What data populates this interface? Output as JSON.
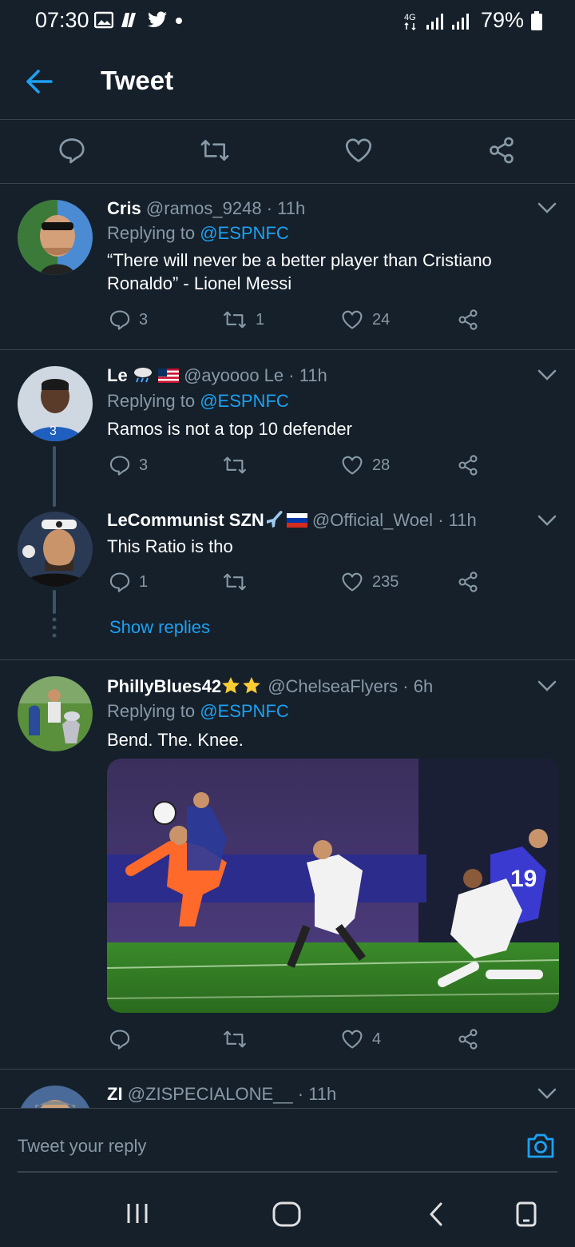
{
  "status_bar": {
    "time": "07:30",
    "network": "4G",
    "battery": "79%"
  },
  "header": {
    "title": "Tweet"
  },
  "tweets": [
    {
      "name": "Cris",
      "handle": "@ramos_9248",
      "time": "· 11h",
      "replying_prefix": "Replying to",
      "replying_to": "@ESPNFC",
      "text": "“There will never be a better player than Cristiano Ronaldo” - Lionel Messi",
      "replies": "3",
      "retweets": "1",
      "likes": "24"
    },
    {
      "name": "Le",
      "handle": "@ayoooo Le",
      "time": "· 11h",
      "replying_prefix": "Replying to",
      "replying_to": "@ESPNFC",
      "text": "Ramos is not a top 10 defender",
      "replies": "3",
      "retweets": "",
      "likes": "28"
    },
    {
      "name": "LeCommunist SZN",
      "handle": "@Official_Woel",
      "time": "· 11h",
      "text": "This Ratio is tho",
      "replies": "1",
      "retweets": "",
      "likes": "235",
      "show_replies": "Show replies"
    },
    {
      "name": "PhillyBlues42",
      "handle": "@ChelseaFlyers",
      "time": "· 6h",
      "replying_prefix": "Replying to",
      "replying_to": "@ESPNFC",
      "text": "Bend. The. Knee.",
      "replies": "",
      "retweets": "",
      "likes": "4"
    },
    {
      "name": "ZI",
      "handle": "@ZISPECIALONE__",
      "time": "· 11h"
    }
  ],
  "reply_bar": {
    "placeholder": "Tweet your reply"
  },
  "colors": {
    "background": "#15202b",
    "accent": "#1da1f2",
    "muted": "#8899a6",
    "divider": "#38444d"
  }
}
